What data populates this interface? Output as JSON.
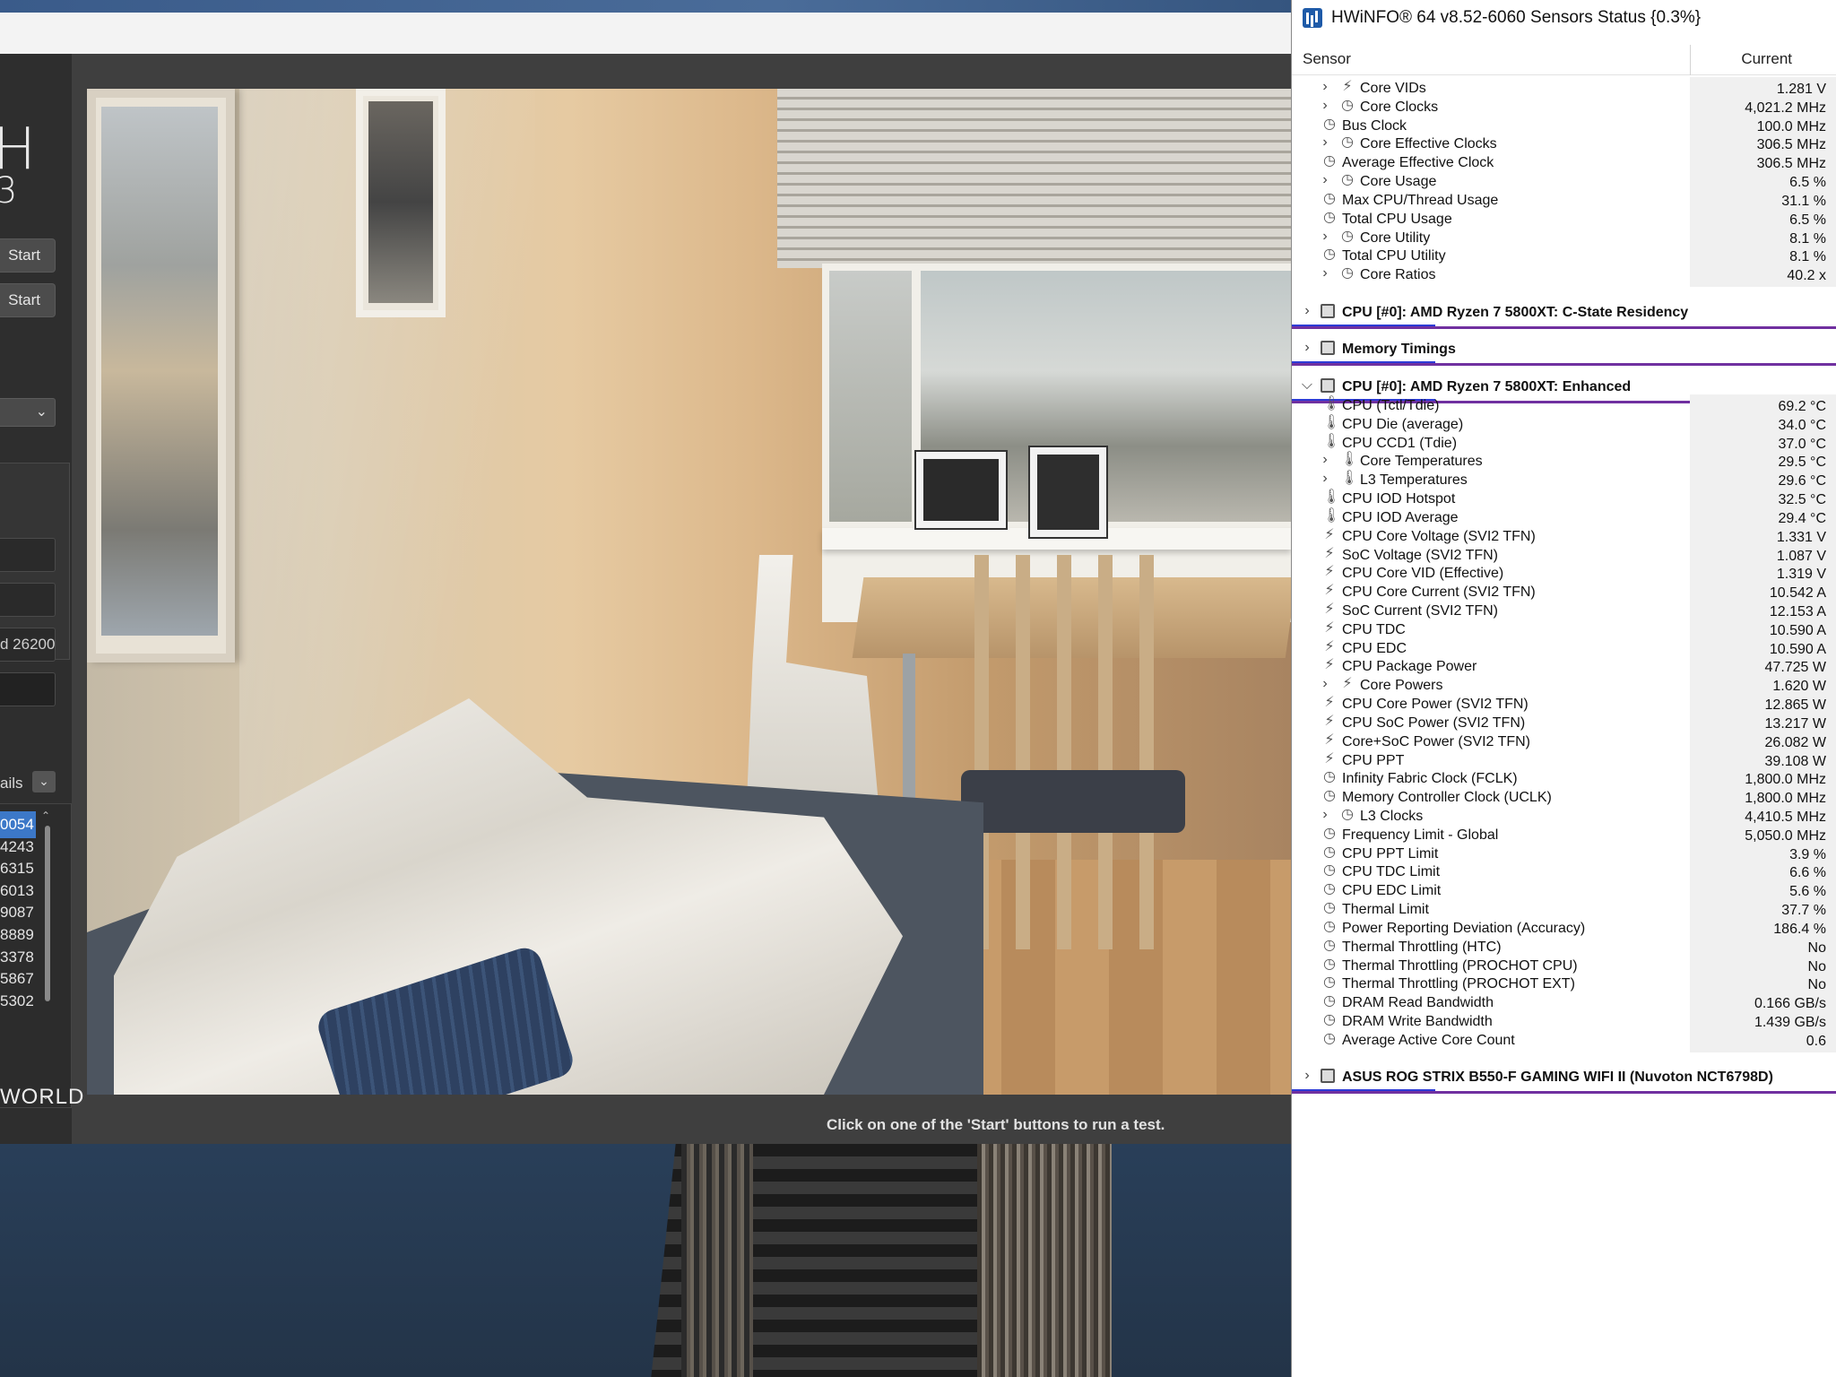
{
  "benchmark": {
    "brand_letter": "H",
    "version_fragment": "3",
    "start_buttons": [
      "Start",
      "Start"
    ],
    "field_values": [
      "",
      "",
      "d 26200",
      ""
    ],
    "details_label": "ails",
    "ranking": [
      "0054",
      "4243",
      "6315",
      "6013",
      "9087",
      "8889",
      "3378",
      "5867",
      "5302"
    ],
    "brand_footer": "WORLD",
    "status": "Click on one of the 'Start' buttons to run a test."
  },
  "hwinfo": {
    "title": "HWiNFO® 64 v8.52-6060 Sensors Status {0.3%}",
    "columns": {
      "sensor": "Sensor",
      "current": "Current"
    },
    "rows": [
      {
        "label": "Core VIDs",
        "value": "1.281 V",
        "icon": "bolt-icon",
        "indent": 1,
        "expandable": true
      },
      {
        "label": "Core Clocks",
        "value": "4,021.2 MHz",
        "icon": "clock-icon",
        "indent": 1,
        "expandable": true
      },
      {
        "label": "Bus Clock",
        "value": "100.0 MHz",
        "icon": "clock-icon",
        "indent": 0,
        "expandable": false
      },
      {
        "label": "Core Effective Clocks",
        "value": "306.5 MHz",
        "icon": "clock-icon",
        "indent": 1,
        "expandable": true
      },
      {
        "label": "Average Effective Clock",
        "value": "306.5 MHz",
        "icon": "clock-icon",
        "indent": 0,
        "expandable": false
      },
      {
        "label": "Core Usage",
        "value": "6.5 %",
        "icon": "clock-icon",
        "indent": 1,
        "expandable": true
      },
      {
        "label": "Max CPU/Thread Usage",
        "value": "31.1 %",
        "icon": "clock-icon",
        "indent": 0,
        "expandable": false
      },
      {
        "label": "Total CPU Usage",
        "value": "6.5 %",
        "icon": "clock-icon",
        "indent": 0,
        "expandable": false
      },
      {
        "label": "Core Utility",
        "value": "8.1 %",
        "icon": "clock-icon",
        "indent": 1,
        "expandable": true
      },
      {
        "label": "Total CPU Utility",
        "value": "8.1 %",
        "icon": "clock-icon",
        "indent": 0,
        "expandable": false
      },
      {
        "label": "Core Ratios",
        "value": "40.2 x",
        "icon": "clock-icon",
        "indent": 1,
        "expandable": true
      },
      {
        "label": "",
        "value": "",
        "type": "spacer"
      },
      {
        "label": "CPU [#0]: AMD Ryzen 7 5800XT: C-State Residency",
        "type": "group",
        "expanded": false
      },
      {
        "label": "",
        "value": "",
        "type": "spacer"
      },
      {
        "label": "Memory Timings",
        "type": "group",
        "expanded": false
      },
      {
        "label": "",
        "value": "",
        "type": "spacer"
      },
      {
        "label": "CPU [#0]: AMD Ryzen 7 5800XT: Enhanced",
        "type": "group",
        "expanded": true
      },
      {
        "label": "CPU (Tctl/Tdie)",
        "value": "69.2 °C",
        "icon": "thermometer-icon",
        "indent": 0,
        "expandable": false
      },
      {
        "label": "CPU Die (average)",
        "value": "34.0 °C",
        "icon": "thermometer-icon",
        "indent": 0,
        "expandable": false
      },
      {
        "label": "CPU CCD1 (Tdie)",
        "value": "37.0 °C",
        "icon": "thermometer-icon",
        "indent": 0,
        "expandable": false
      },
      {
        "label": "Core Temperatures",
        "value": "29.5 °C",
        "icon": "thermometer-icon",
        "indent": 1,
        "expandable": true
      },
      {
        "label": "L3 Temperatures",
        "value": "29.6 °C",
        "icon": "thermometer-icon",
        "indent": 1,
        "expandable": true
      },
      {
        "label": "CPU IOD Hotspot",
        "value": "32.5 °C",
        "icon": "thermometer-icon",
        "indent": 0,
        "expandable": false
      },
      {
        "label": "CPU IOD Average",
        "value": "29.4 °C",
        "icon": "thermometer-icon",
        "indent": 0,
        "expandable": false
      },
      {
        "label": "CPU Core Voltage (SVI2 TFN)",
        "value": "1.331 V",
        "icon": "bolt-icon",
        "indent": 0,
        "expandable": false
      },
      {
        "label": "SoC Voltage (SVI2 TFN)",
        "value": "1.087 V",
        "icon": "bolt-icon",
        "indent": 0,
        "expandable": false
      },
      {
        "label": "CPU Core VID (Effective)",
        "value": "1.319 V",
        "icon": "bolt-icon",
        "indent": 0,
        "expandable": false
      },
      {
        "label": "CPU Core Current (SVI2 TFN)",
        "value": "10.542 A",
        "icon": "bolt-icon",
        "indent": 0,
        "expandable": false
      },
      {
        "label": "SoC Current (SVI2 TFN)",
        "value": "12.153 A",
        "icon": "bolt-icon",
        "indent": 0,
        "expandable": false
      },
      {
        "label": "CPU TDC",
        "value": "10.590 A",
        "icon": "bolt-icon",
        "indent": 0,
        "expandable": false
      },
      {
        "label": "CPU EDC",
        "value": "10.590 A",
        "icon": "bolt-icon",
        "indent": 0,
        "expandable": false
      },
      {
        "label": "CPU Package Power",
        "value": "47.725 W",
        "icon": "bolt-icon",
        "indent": 0,
        "expandable": false
      },
      {
        "label": "Core Powers",
        "value": "1.620 W",
        "icon": "bolt-icon",
        "indent": 1,
        "expandable": true
      },
      {
        "label": "CPU Core Power (SVI2 TFN)",
        "value": "12.865 W",
        "icon": "bolt-icon",
        "indent": 0,
        "expandable": false
      },
      {
        "label": "CPU SoC Power (SVI2 TFN)",
        "value": "13.217 W",
        "icon": "bolt-icon",
        "indent": 0,
        "expandable": false
      },
      {
        "label": "Core+SoC Power (SVI2 TFN)",
        "value": "26.082 W",
        "icon": "bolt-icon",
        "indent": 0,
        "expandable": false
      },
      {
        "label": "CPU PPT",
        "value": "39.108 W",
        "icon": "bolt-icon",
        "indent": 0,
        "expandable": false
      },
      {
        "label": "Infinity Fabric Clock (FCLK)",
        "value": "1,800.0 MHz",
        "icon": "clock-icon",
        "indent": 0,
        "expandable": false
      },
      {
        "label": "Memory Controller Clock (UCLK)",
        "value": "1,800.0 MHz",
        "icon": "clock-icon",
        "indent": 0,
        "expandable": false
      },
      {
        "label": "L3 Clocks",
        "value": "4,410.5 MHz",
        "icon": "clock-icon",
        "indent": 1,
        "expandable": true
      },
      {
        "label": "Frequency Limit - Global",
        "value": "5,050.0 MHz",
        "icon": "clock-icon",
        "indent": 0,
        "expandable": false
      },
      {
        "label": "CPU PPT Limit",
        "value": "3.9 %",
        "icon": "clock-icon",
        "indent": 0,
        "expandable": false
      },
      {
        "label": "CPU TDC Limit",
        "value": "6.6 %",
        "icon": "clock-icon",
        "indent": 0,
        "expandable": false
      },
      {
        "label": "CPU EDC Limit",
        "value": "5.6 %",
        "icon": "clock-icon",
        "indent": 0,
        "expandable": false
      },
      {
        "label": "Thermal Limit",
        "value": "37.7 %",
        "icon": "clock-icon",
        "indent": 0,
        "expandable": false
      },
      {
        "label": "Power Reporting Deviation (Accuracy)",
        "value": "186.4 %",
        "icon": "clock-icon",
        "indent": 0,
        "expandable": false
      },
      {
        "label": "Thermal Throttling (HTC)",
        "value": "No",
        "icon": "clock-icon",
        "indent": 0,
        "expandable": false
      },
      {
        "label": "Thermal Throttling (PROCHOT CPU)",
        "value": "No",
        "icon": "clock-icon",
        "indent": 0,
        "expandable": false
      },
      {
        "label": "Thermal Throttling (PROCHOT EXT)",
        "value": "No",
        "icon": "clock-icon",
        "indent": 0,
        "expandable": false
      },
      {
        "label": "DRAM Read Bandwidth",
        "value": "0.166 GB/s",
        "icon": "clock-icon",
        "indent": 0,
        "expandable": false
      },
      {
        "label": "DRAM Write Bandwidth",
        "value": "1.439 GB/s",
        "icon": "clock-icon",
        "indent": 0,
        "expandable": false
      },
      {
        "label": "Average Active Core Count",
        "value": "0.6",
        "icon": "clock-icon",
        "indent": 0,
        "expandable": false
      },
      {
        "label": "",
        "value": "",
        "type": "spacer"
      },
      {
        "label": "ASUS ROG STRIX B550-F GAMING WIFI II (Nuvoton NCT6798D)",
        "type": "group",
        "expanded": false
      }
    ],
    "group_line_color": "#7030a0",
    "group_line_accent": "#2d3bd6"
  },
  "icons": {
    "bolt-icon": "⚡",
    "clock-icon": "◷",
    "thermometer-icon": "🌡",
    "chevron-right-icon": "›",
    "chevron-down-icon": "⌄"
  }
}
